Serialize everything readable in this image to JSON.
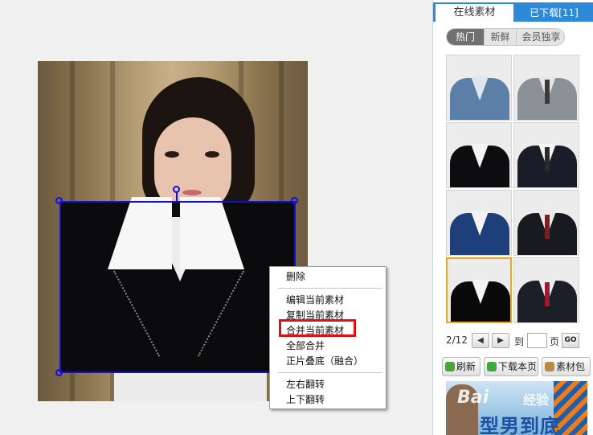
{
  "context_menu": {
    "items": [
      "删除",
      "编辑当前素材",
      "复制当前素材",
      "合并当前素材",
      "全部合并",
      "正片叠底（融合）",
      "左右翻转",
      "上下翻转"
    ],
    "highlighted": "合并当前素材"
  },
  "panel": {
    "tabs": {
      "online": "在线素材",
      "downloaded": "已下载[11]"
    },
    "filters": {
      "hot": "热门",
      "new": "新鲜",
      "vip": "会员独享"
    },
    "thumbnails": [
      {
        "suit": "#5b7fa6",
        "shirt": "#dfe6ee",
        "tie": "none"
      },
      {
        "suit": "#8c9097",
        "shirt": "#e6e6e6",
        "tie": "#3a3a3a"
      },
      {
        "suit": "#0d0d0f",
        "shirt": "#f4f4f4",
        "tie": "none"
      },
      {
        "suit": "#1a1d28",
        "shirt": "#f4f4f4",
        "tie": "#2a2a2a"
      },
      {
        "suit": "#1e3f7a",
        "shirt": "#f4f4f4",
        "tie": "none"
      },
      {
        "suit": "#181a20",
        "shirt": "#eaeaea",
        "tie": "#7a2020"
      },
      {
        "suit": "#0a0a0a",
        "shirt": "#f4f4f4",
        "tie": "none"
      },
      {
        "suit": "#1c1f27",
        "shirt": "#e9eef5",
        "tie": "#a01c2c"
      }
    ],
    "selected_thumbnail": 7,
    "pager": {
      "text": "2/12",
      "prev": "◀",
      "next": "▶",
      "to": "到",
      "page": "页",
      "go": "GO"
    },
    "buttons": {
      "refresh": "刷新",
      "download_page": "下载本页",
      "pack": "素材包"
    },
    "ad": {
      "headline": "型男到底",
      "watermark": "Bai",
      "watermark2": "经验"
    }
  },
  "colors": {
    "accent_blue": "#2d8ad9",
    "selection_blue": "#1010d8",
    "highlight_red": "#e01010",
    "selected_border": "#f4a71a"
  }
}
